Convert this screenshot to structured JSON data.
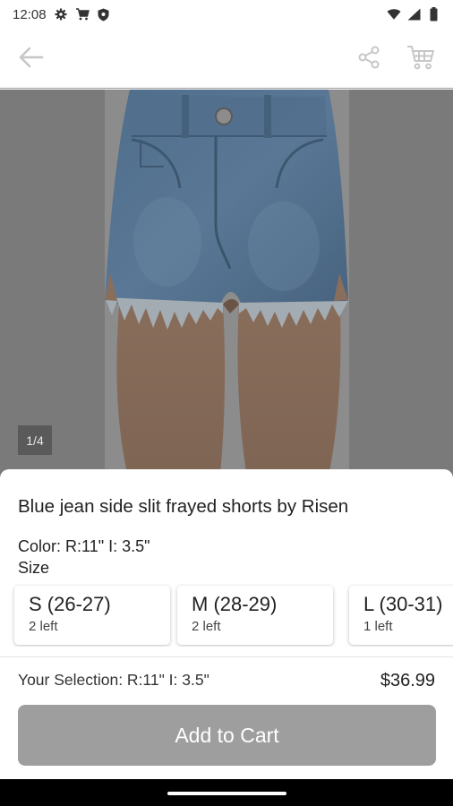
{
  "status_bar": {
    "time": "12:08",
    "left_icons": [
      "gear-icon",
      "cart-icon",
      "shield-icon"
    ],
    "right_icons": [
      "wifi-icon",
      "signal-icon",
      "battery-icon"
    ]
  },
  "app_bar": {
    "back_icon": "arrow-left-icon",
    "share_icon": "share-icon",
    "cart_icon": "shopping-cart-icon"
  },
  "gallery": {
    "counter": "1/4",
    "current": 1,
    "total": 4
  },
  "product": {
    "title": "Blue jean side slit frayed shorts by Risen",
    "color_line": "Color: R:11\" I: 3.5\"",
    "size_label": "Size",
    "sizes": [
      {
        "name": "S (26-27)",
        "stock": "2 left"
      },
      {
        "name": "M (28-29)",
        "stock": "2 left"
      },
      {
        "name": "L (30-31)",
        "stock": "1 left"
      }
    ],
    "selection": "Your Selection: R:11\" I: 3.5\"",
    "price": "$36.99",
    "add_to_cart": "Add to Cart"
  },
  "colors": {
    "overlay": "#7a7a7a",
    "button_disabled": "#9e9e9e",
    "denim": "#4a6b8a"
  }
}
